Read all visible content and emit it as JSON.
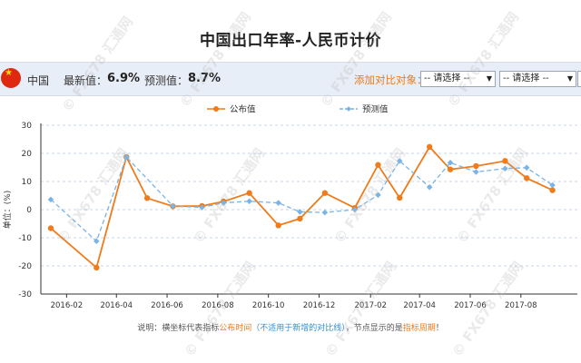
{
  "page": {
    "title": "中国出口年率-人民币计价",
    "country": "中国",
    "latest_label": "最新值：",
    "latest_value": "6.9%",
    "forecast_label": "预测值：",
    "forecast_value": "8.7%",
    "compare_label": "添加对比对象：",
    "select1": "-- 请选择 --",
    "select2": "-- 请选择 --",
    "note_prefix": "说明：横坐标代表指标",
    "note_orange1": "公布时间",
    "note_blue": "（不适用于新增的对比线）",
    "note_mid": "，节点显示的是",
    "note_orange2": "指标周期",
    "note_end": "！",
    "watermark": "FX678 汇通网"
  },
  "colors": {
    "actual": "#f07b1a",
    "forecast": "#7ab4e6",
    "axis": "#333333",
    "grid": "#c9d6e8"
  },
  "chart_data": {
    "type": "line",
    "ylabel": "单位：(%)",
    "ylim": [
      -30,
      30
    ],
    "yticks": [
      -30,
      -20,
      -10,
      0,
      10,
      20,
      30
    ],
    "xlim": [
      "2016-01-01",
      "2017-10-08"
    ],
    "xticks": [
      "2016-02",
      "2016-04",
      "2016-06",
      "2016-08",
      "2016-10",
      "2016-12",
      "2017-02",
      "2017-04",
      "2017-06",
      "2017-08"
    ],
    "series": [
      {
        "name": "公布值",
        "style": "solid",
        "points": [
          {
            "x": "2016-01-13",
            "y": -6.6
          },
          {
            "x": "2016-03-08",
            "y": -20.6
          },
          {
            "x": "2016-04-13",
            "y": 18.7
          },
          {
            "x": "2016-05-08",
            "y": 4.1
          },
          {
            "x": "2016-06-08",
            "y": 1.2
          },
          {
            "x": "2016-07-13",
            "y": 1.3
          },
          {
            "x": "2016-08-08",
            "y": 2.9
          },
          {
            "x": "2016-09-08",
            "y": 5.9
          },
          {
            "x": "2016-10-13",
            "y": -5.6
          },
          {
            "x": "2016-11-08",
            "y": -3.2
          },
          {
            "x": "2016-12-08",
            "y": 5.9
          },
          {
            "x": "2017-01-13",
            "y": 0.6
          },
          {
            "x": "2017-02-10",
            "y": 15.9
          },
          {
            "x": "2017-03-08",
            "y": 4.2
          },
          {
            "x": "2017-04-13",
            "y": 22.3
          },
          {
            "x": "2017-05-08",
            "y": 14.3
          },
          {
            "x": "2017-06-08",
            "y": 15.5
          },
          {
            "x": "2017-07-13",
            "y": 17.3
          },
          {
            "x": "2017-08-08",
            "y": 11.2
          },
          {
            "x": "2017-09-08",
            "y": 6.9
          }
        ]
      },
      {
        "name": "预测值",
        "style": "dashed",
        "points": [
          {
            "x": "2016-01-13",
            "y": 3.6
          },
          {
            "x": "2016-03-08",
            "y": -11.2
          },
          {
            "x": "2016-04-13",
            "y": 18.7
          },
          {
            "x": "2016-06-08",
            "y": 1.3
          },
          {
            "x": "2016-07-13",
            "y": 0.8
          },
          {
            "x": "2016-08-08",
            "y": 2.4
          },
          {
            "x": "2016-09-08",
            "y": 3.0
          },
          {
            "x": "2016-10-13",
            "y": 2.4
          },
          {
            "x": "2016-11-08",
            "y": -0.8
          },
          {
            "x": "2016-12-08",
            "y": -1.0
          },
          {
            "x": "2017-01-13",
            "y": 0.0
          },
          {
            "x": "2017-02-10",
            "y": 5.2
          },
          {
            "x": "2017-03-08",
            "y": 17.3
          },
          {
            "x": "2017-04-13",
            "y": 8.0
          },
          {
            "x": "2017-05-08",
            "y": 16.7
          },
          {
            "x": "2017-06-08",
            "y": 13.4
          },
          {
            "x": "2017-07-13",
            "y": 14.6
          },
          {
            "x": "2017-08-08",
            "y": 14.9
          },
          {
            "x": "2017-09-08",
            "y": 8.7
          }
        ]
      }
    ]
  }
}
